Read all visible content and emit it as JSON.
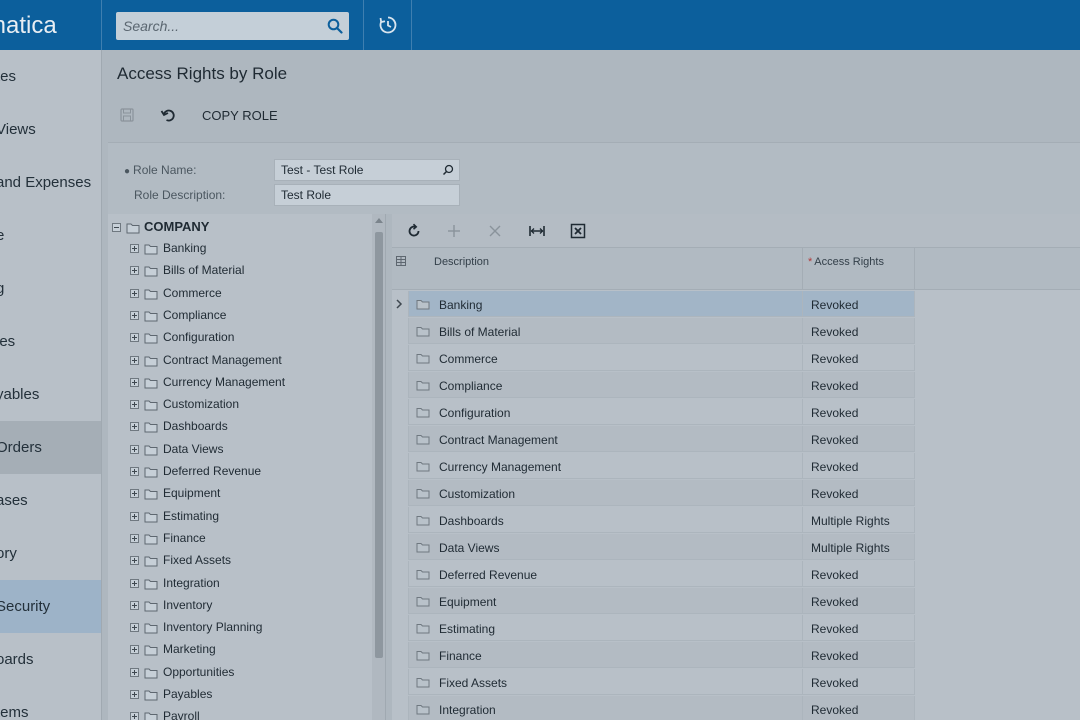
{
  "brand": {
    "text": "matica"
  },
  "search": {
    "placeholder": "Search..."
  },
  "sidebar": {
    "items": [
      {
        "label": "tes"
      },
      {
        "label": "Views"
      },
      {
        "label": "and Expenses"
      },
      {
        "label": "e"
      },
      {
        "label": "g"
      },
      {
        "label": "les"
      },
      {
        "label": "yables"
      },
      {
        "label": "Orders"
      },
      {
        "label": "ases"
      },
      {
        "label": "ory"
      },
      {
        "label": "Security"
      },
      {
        "label": "oards"
      },
      {
        "label": "tems"
      }
    ]
  },
  "page": {
    "title": "Access Rights by Role"
  },
  "toolbar": {
    "copy_role_label": "COPY ROLE"
  },
  "form": {
    "role_name_label": "Role Name:",
    "role_name_value": "Test - Test Role",
    "role_description_label": "Role Description:",
    "role_description_value": "Test Role"
  },
  "tree": {
    "root": "COMPANY",
    "nodes": [
      "Banking",
      "Bills of Material",
      "Commerce",
      "Compliance",
      "Configuration",
      "Contract Management",
      "Currency Management",
      "Customization",
      "Dashboards",
      "Data Views",
      "Deferred Revenue",
      "Equipment",
      "Estimating",
      "Finance",
      "Fixed Assets",
      "Integration",
      "Inventory",
      "Inventory Planning",
      "Marketing",
      "Opportunities",
      "Payables",
      "Payroll"
    ]
  },
  "grid": {
    "headers": {
      "description": "Description",
      "access_rights": "Access Rights"
    },
    "rows": [
      {
        "description": "Banking",
        "access_rights": "Revoked"
      },
      {
        "description": "Bills of Material",
        "access_rights": "Revoked"
      },
      {
        "description": "Commerce",
        "access_rights": "Revoked"
      },
      {
        "description": "Compliance",
        "access_rights": "Revoked"
      },
      {
        "description": "Configuration",
        "access_rights": "Revoked"
      },
      {
        "description": "Contract Management",
        "access_rights": "Revoked"
      },
      {
        "description": "Currency Management",
        "access_rights": "Revoked"
      },
      {
        "description": "Customization",
        "access_rights": "Revoked"
      },
      {
        "description": "Dashboards",
        "access_rights": "Multiple Rights"
      },
      {
        "description": "Data Views",
        "access_rights": "Multiple Rights"
      },
      {
        "description": "Deferred Revenue",
        "access_rights": "Revoked"
      },
      {
        "description": "Equipment",
        "access_rights": "Revoked"
      },
      {
        "description": "Estimating",
        "access_rights": "Revoked"
      },
      {
        "description": "Finance",
        "access_rights": "Revoked"
      },
      {
        "description": "Fixed Assets",
        "access_rights": "Revoked"
      },
      {
        "description": "Integration",
        "access_rights": "Revoked"
      }
    ]
  },
  "colors": {
    "topbar": "#0c5f9c",
    "selected_row": "#a2b5c7"
  },
  "icons": {
    "search": "search-icon",
    "history": "history-icon",
    "save": "save-icon",
    "undo": "undo-icon",
    "refresh": "refresh-icon",
    "add": "add-icon",
    "delete": "delete-icon",
    "fit": "fit-columns-icon",
    "excel": "export-excel-icon",
    "folder": "folder-icon"
  }
}
